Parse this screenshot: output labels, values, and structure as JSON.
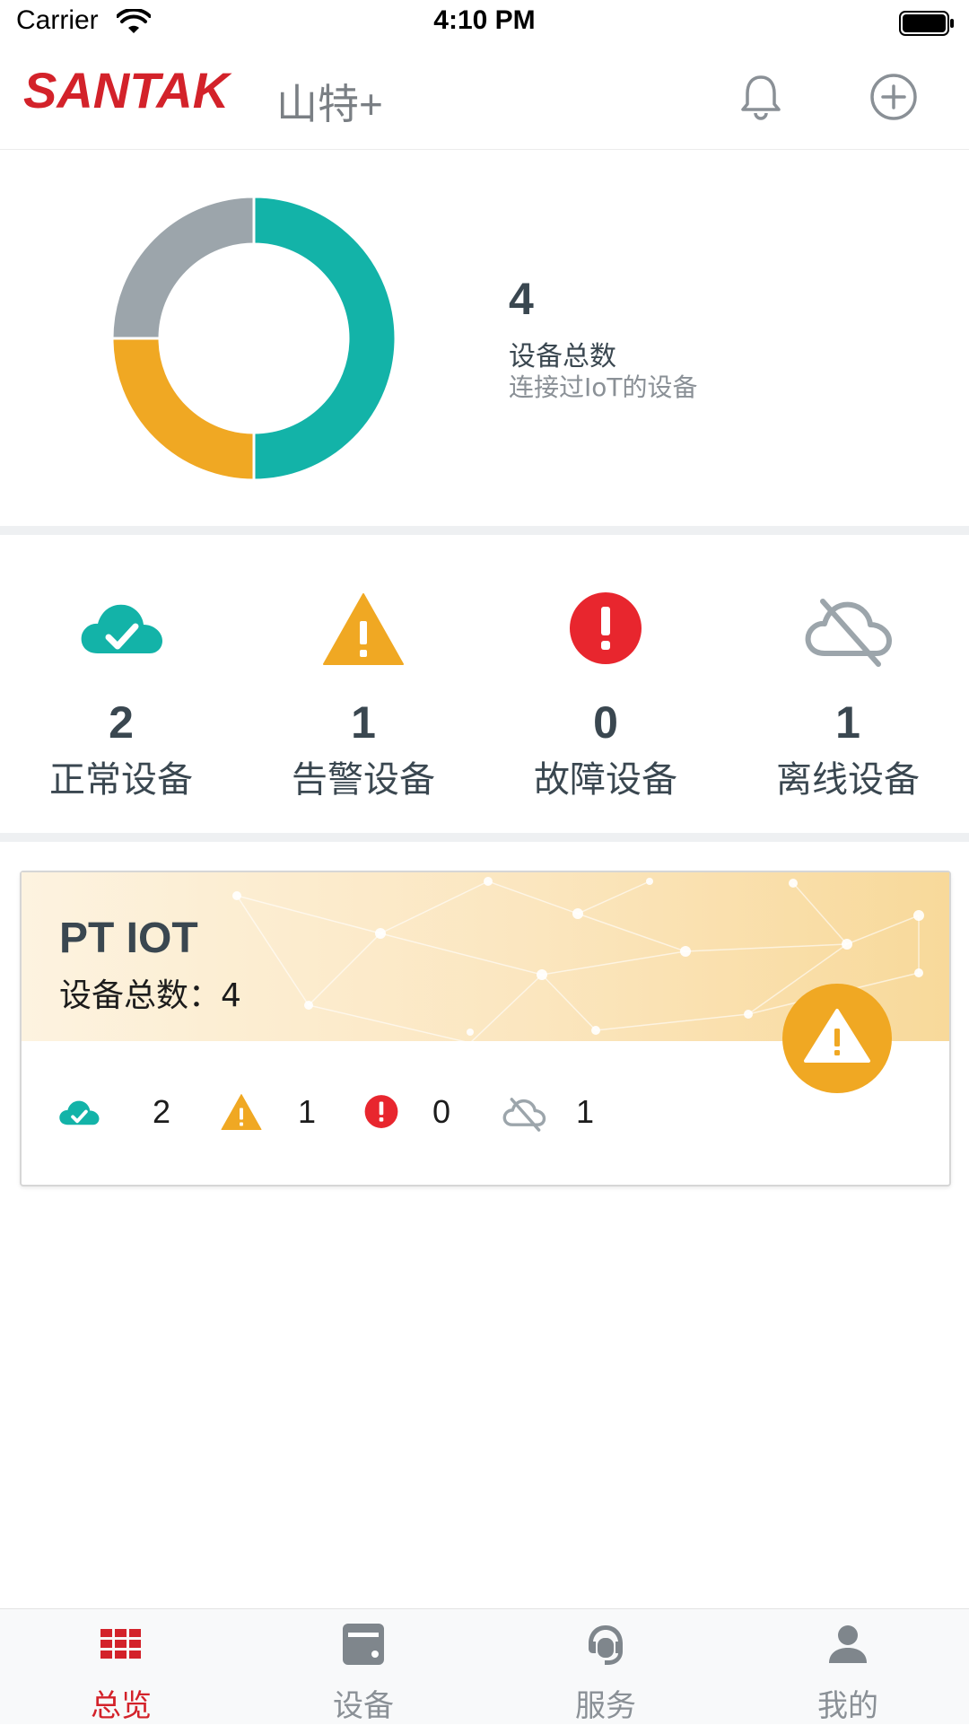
{
  "status_bar": {
    "carrier": "Carrier",
    "time": "4:10 PM"
  },
  "header": {
    "logo_text": "SANTAK",
    "title": "山特+",
    "icons": [
      "bell-icon",
      "add-circle-icon"
    ]
  },
  "summary": {
    "total": "4",
    "total_label": "设备总数",
    "total_sub": "连接过IoT的设备"
  },
  "chart_data": {
    "type": "pie",
    "categories": [
      "正常设备",
      "告警设备",
      "故障设备",
      "离线设备"
    ],
    "values": [
      2,
      1,
      0,
      1
    ],
    "colors": [
      "#13b3a8",
      "#f0a823",
      "#e8262e",
      "#9ca5ab"
    ],
    "title": ""
  },
  "stats": [
    {
      "count": "2",
      "label": "正常设备",
      "icon": "cloud-check-icon",
      "color": "#13b3a8"
    },
    {
      "count": "1",
      "label": "告警设备",
      "icon": "warning-triangle-icon",
      "color": "#f0a823"
    },
    {
      "count": "0",
      "label": "故障设备",
      "icon": "error-circle-icon",
      "color": "#e8262e"
    },
    {
      "count": "1",
      "label": "离线设备",
      "icon": "cloud-offline-icon",
      "color": "#9ca5ab"
    }
  ],
  "card": {
    "title": "PT IOT",
    "total_text": "设备总数：4",
    "status_icon": "warning-triangle-icon",
    "counts": [
      "2",
      "1",
      "0",
      "1"
    ]
  },
  "tabs": [
    {
      "label": "总览",
      "icon": "grid-icon",
      "active": true
    },
    {
      "label": "设备",
      "icon": "device-icon",
      "active": false
    },
    {
      "label": "服务",
      "icon": "headset-icon",
      "active": false
    },
    {
      "label": "我的",
      "icon": "person-icon",
      "active": false
    }
  ],
  "colors": {
    "brand": "#d3222a",
    "normal": "#13b3a8",
    "warning": "#f0a823",
    "fault": "#e8262e",
    "offline": "#9ca5ab",
    "text": "#3a4750"
  }
}
